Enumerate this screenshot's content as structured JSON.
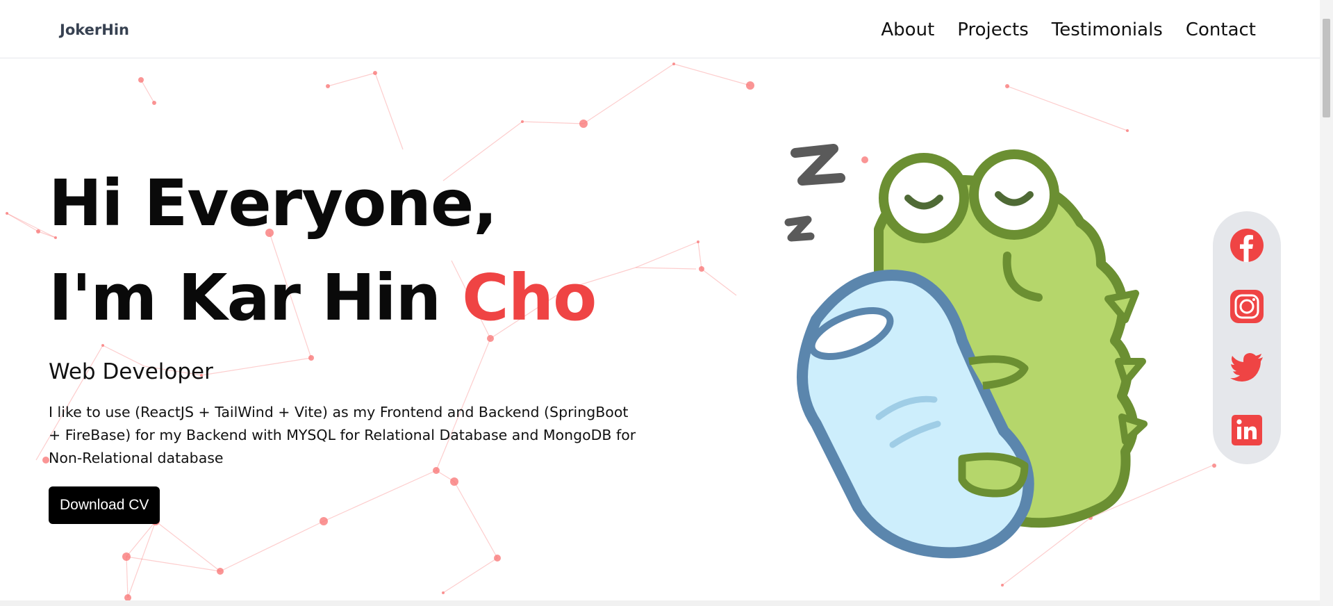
{
  "nav": {
    "brand": "JokerHin",
    "links": [
      "About",
      "Projects",
      "Testimonials",
      "Contact"
    ]
  },
  "hero": {
    "greeting": "Hi Everyone,",
    "intro_prefix": "I'm Kar Hin ",
    "intro_highlight": "Cho",
    "role": "Web Developer",
    "bio": "I like to use (ReactJS + TailWind + Vite) as my Frontend and Backend (SpringBoot + FireBase) for my Backend with MYSQL for Relational Database and MongoDB for Non-Relational database",
    "cta_label": "Download CV"
  },
  "social": [
    "facebook-icon",
    "instagram-icon",
    "twitter-icon",
    "linkedin-icon"
  ],
  "colors": {
    "accent": "#ef4444",
    "button_bg": "#000000",
    "frog_green": "#b5d66b",
    "frog_outline": "#6b8f32",
    "pillow_blue": "#cdeefc",
    "pillow_outline": "#5b86ad",
    "social_bar_bg": "#e5e7eb"
  }
}
